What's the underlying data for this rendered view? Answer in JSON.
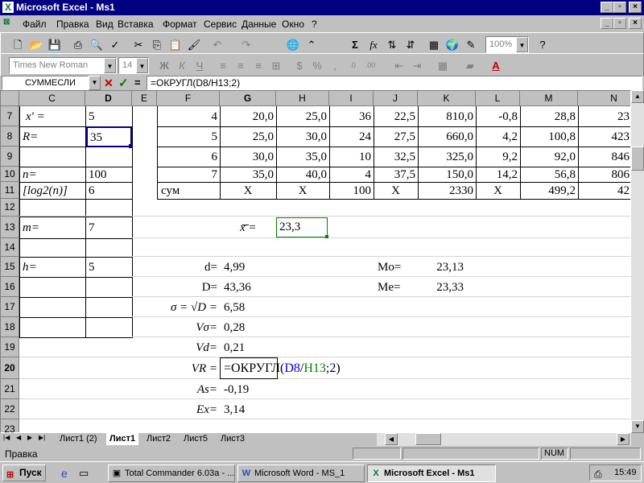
{
  "window": {
    "title": "Microsoft Excel - Ms1",
    "icon": "excel-icon"
  },
  "menu": [
    "Файл",
    "Правка",
    "Вид",
    "Вставка",
    "Формат",
    "Сервис",
    "Данные",
    "Окно",
    "?"
  ],
  "toolbar": {
    "zoom": "100%",
    "font": "Times New Roman",
    "font_size": "14",
    "bold": "Ж",
    "italic": "К",
    "underline": "Ч",
    "percent": "%",
    "comma": ",",
    "sigma": "Σ",
    "fx": "fx"
  },
  "formula_bar": {
    "name_box": "СУММЕСЛИ",
    "cancel": "✕",
    "enter": "✓",
    "equals": "=",
    "formula": "=ОКРУГЛ(D8/H13;2)"
  },
  "columns": [
    "C",
    "D",
    "E",
    "F",
    "G",
    "H",
    "I",
    "J",
    "K",
    "L",
    "M",
    "N"
  ],
  "rows": [
    "7",
    "8",
    "9",
    "10",
    "11",
    "12",
    "13",
    "14",
    "15",
    "16",
    "17",
    "18",
    "19",
    "20",
    "21",
    "22",
    "23"
  ],
  "cells": {
    "c7": "x'  =",
    "d7": "5",
    "c8": "R=",
    "d8": "35",
    "c10": "n=",
    "d10": "100",
    "c11": "[log2(n)]",
    "d11": "6",
    "c13": "m=",
    "d13": "7",
    "c15": "h=",
    "d15": "5",
    "table": [
      [
        "4",
        "20,0",
        "25,0",
        "36",
        "22,5",
        "810,0",
        "-0,8",
        "28,8",
        "23"
      ],
      [
        "5",
        "25,0",
        "30,0",
        "24",
        "27,5",
        "660,0",
        "4,2",
        "100,8",
        "423"
      ],
      [
        "6",
        "30,0",
        "35,0",
        "10",
        "32,5",
        "325,0",
        "9,2",
        "92,0",
        "846"
      ],
      [
        "7",
        "35,0",
        "40,0",
        "4",
        "37,5",
        "150,0",
        "14,2",
        "56,8",
        "806"
      ],
      [
        "сум",
        "X",
        "X",
        "100",
        "X",
        "2330",
        "X",
        "499,2",
        "42"
      ]
    ],
    "g13": "x   =",
    "h13": "23,3",
    "f15": "d=",
    "g15": "4,99",
    "f16": "D=",
    "g16": "43,36",
    "f17": "σ = √D =",
    "g17": "6,58",
    "f18": "Vσ=",
    "g18": "0,28",
    "f19": "Vd=",
    "g19": "0,21",
    "f20": "VR =",
    "g20_pre": "=ОКРУГЛ(",
    "g20_ref1": "D8",
    "g20_mid": "/",
    "g20_ref2": "H13",
    "g20_post": ";2)",
    "f21": "As=",
    "g21": "-0,19",
    "f22": "Ex=",
    "g22": "3,14",
    "j15": "Mo=",
    "k15": "23,13",
    "j16": "Me=",
    "k16": "23,33"
  },
  "sheet_tabs": [
    "Лист1 (2)",
    "Лист1",
    "Лист2",
    "Лист5",
    "Лист3"
  ],
  "active_sheet": "Лист1",
  "status": {
    "mode": "Правка",
    "num": "NUM"
  },
  "taskbar": {
    "start": "Пуск",
    "tasks": [
      "Total Commander 6.03a - ...",
      "Microsoft Word - MS_1",
      "Microsoft Excel - Ms1"
    ],
    "clock": "15:49"
  },
  "colors": {
    "titlebar": "#000080",
    "ref_blue": "#0000ff",
    "ref_green": "#008000",
    "selection": "#008000"
  }
}
